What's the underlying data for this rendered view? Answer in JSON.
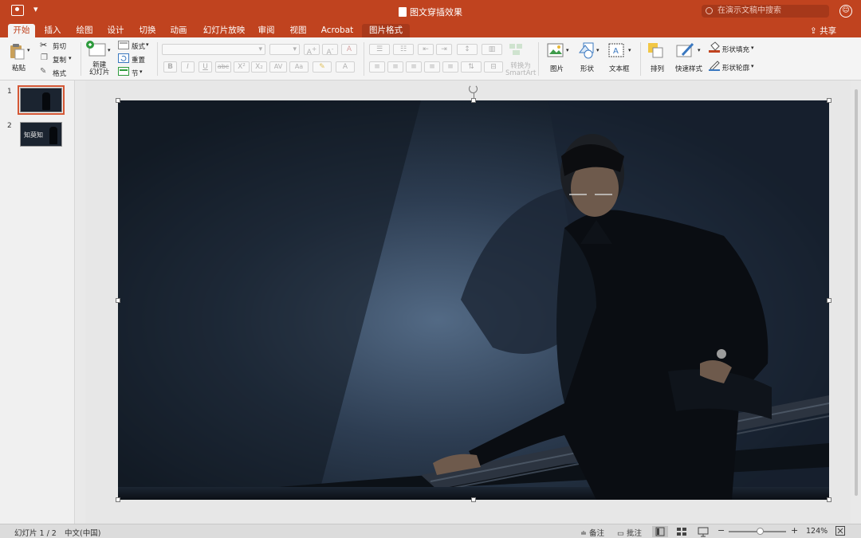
{
  "window": {
    "title": "图文穿插效果",
    "search_placeholder": "在演示文稿中搜索",
    "share_label": "共享",
    "icons": [
      "powerpoint-app-icon",
      "quick-access-dropdown-icon",
      "document-icon",
      "search-icon",
      "smiley-feedback-icon",
      "share-icon"
    ]
  },
  "tabs": [
    {
      "label": "开始",
      "active": true
    },
    {
      "label": "插入"
    },
    {
      "label": "绘图"
    },
    {
      "label": "设计"
    },
    {
      "label": "切换"
    },
    {
      "label": "动画"
    },
    {
      "label": "幻灯片放映"
    },
    {
      "label": "审阅"
    },
    {
      "label": "视图"
    },
    {
      "label": "Acrobat"
    },
    {
      "label": "图片格式",
      "contextual": true
    }
  ],
  "ribbon": {
    "clipboard": {
      "paste": "粘贴",
      "cut": "剪切",
      "copy": "复制",
      "format": "格式"
    },
    "slides": {
      "new_slide": "新建\n幻灯片",
      "layout": "版式",
      "reset": "重置",
      "section": "节"
    },
    "font": {
      "bold": "B",
      "italic": "I",
      "underline": "U",
      "strike": "abc",
      "superscript": "X²",
      "subscript": "X₂",
      "char_spacing": "AV",
      "change_case": "Aa",
      "font_color": "A"
    },
    "paragraph": {
      "convert_smartart": "转换为\nSmartArt"
    },
    "insert": {
      "picture": "图片",
      "shape": "形状",
      "textbox": "文本框"
    },
    "drawing": {
      "arrange": "排列",
      "quick_styles": "快速样式",
      "shape_fill": "形状填充",
      "shape_outline": "形状轮廓"
    }
  },
  "slides_panel": {
    "slides": [
      {
        "number": "1",
        "selected": true
      },
      {
        "number": "2",
        "text": "知莫知"
      }
    ]
  },
  "status": {
    "slide_indicator": "幻灯片 1 / 2",
    "language": "中文(中国)",
    "notes": "备注",
    "comments": "批注",
    "zoom_minus": "−",
    "zoom_plus": "+",
    "zoom_level": "124%",
    "zoom_fraction": 0.5
  },
  "colors": {
    "accent": "#c0431f",
    "accent_dark": "#a8391b",
    "thumb_selected": "#d45735"
  }
}
